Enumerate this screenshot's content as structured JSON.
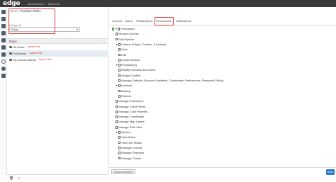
{
  "header": {
    "logo": "edge",
    "links": [
      "adminSearch",
      "Welcome"
    ]
  },
  "breadcrumb": {
    "parent": "Admin",
    "current": "Provision Roles"
  },
  "role_select": {
    "label": "Manage By",
    "value": "Roles"
  },
  "roles": {
    "title": "Roles",
    "items": [
      {
        "name": "All Users",
        "note": "System Role"
      },
      {
        "name": "Full Admin",
        "note": "System Role",
        "selected": true
      },
      {
        "name": "My Domain Admin",
        "note": "System Role"
      }
    ]
  },
  "tabs": [
    "Content",
    "Users",
    "Partial Admin",
    "Permissions",
    "Notifications"
  ],
  "tree": [
    {
      "label": "Permission",
      "level": 0,
      "exp": "▼",
      "check": true
    },
    {
      "label": "Browser Access",
      "level": 1
    },
    {
      "label": "Edit Pipeline",
      "level": 1
    },
    {
      "label": "Content (Pages, Folders, & Actions)",
      "level": 1,
      "exp": "▼"
    },
    {
      "label": "View",
      "level": 2
    },
    {
      "label": "Edit",
      "level": 2
    },
    {
      "label": "Invoke Actions",
      "level": 2
    },
    {
      "label": "Provisioning",
      "level": 1,
      "exp": "▼"
    },
    {
      "label": "Modify Domains and Users",
      "level": 2
    },
    {
      "label": "Assign Content",
      "level": 2
    },
    {
      "label": "Manage Defaults (Secured Variables, Credentials, Preferences, Password Policy)",
      "level": 2
    },
    {
      "label": "Archives",
      "level": 1,
      "exp": "▼"
    },
    {
      "label": "Backup",
      "level": 2
    },
    {
      "label": "Restore",
      "level": 2
    },
    {
      "label": "Manage Extensions",
      "level": 1
    },
    {
      "label": "Manage Client Filters",
      "level": 1
    },
    {
      "label": "Manage Color Palettes",
      "level": 1
    },
    {
      "label": "Manage Constraints",
      "level": 1
    },
    {
      "label": "Manage Map Layers",
      "level": 1
    },
    {
      "label": "Manage Rule Sets",
      "level": 1
    },
    {
      "label": "System",
      "level": 1,
      "exp": "▼"
    },
    {
      "label": "View About",
      "level": 2
    },
    {
      "label": "View Job Status",
      "level": 2
    },
    {
      "label": "Manage License",
      "level": 2
    },
    {
      "label": "Manage Sessions",
      "level": 2
    },
    {
      "label": "Manage Cluster",
      "level": 2
    }
  ],
  "footer": {
    "expand_label": "Expand Assigned",
    "save_label": "Save"
  }
}
